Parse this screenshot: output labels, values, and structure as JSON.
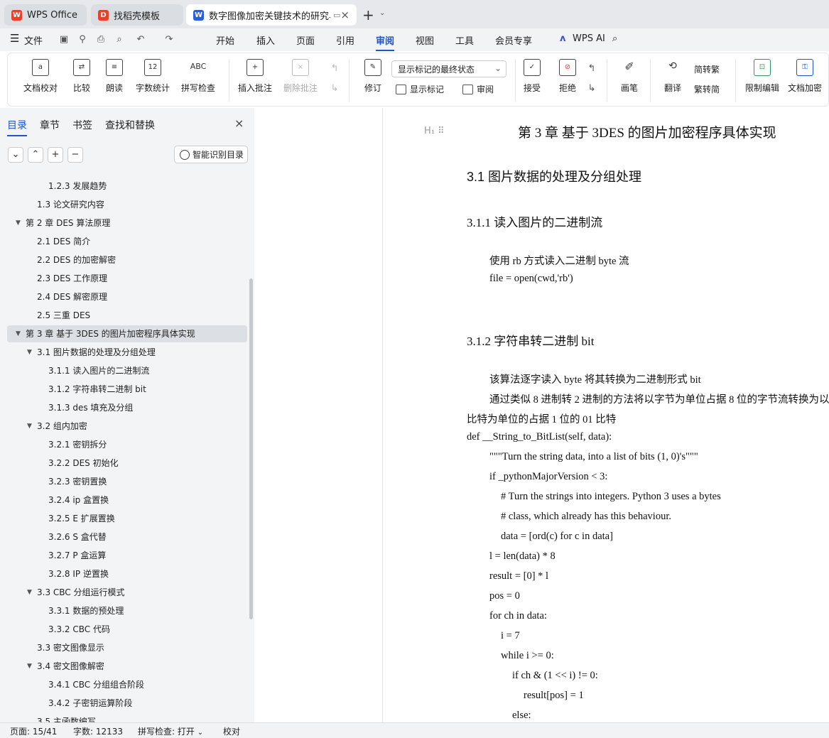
{
  "tabs": [
    {
      "label": "WPS Office",
      "icon": "wps-logo-icon",
      "active": false
    },
    {
      "label": "找稻壳模板",
      "icon": "docer-template-icon",
      "active": false
    },
    {
      "label": "数字图像加密关键技术的研究与",
      "icon": "word-doc-icon",
      "active": true
    }
  ],
  "menubar": {
    "file": "文件",
    "items": [
      "开始",
      "插入",
      "页面",
      "引用",
      "审阅",
      "视图",
      "工具",
      "会员专享"
    ],
    "active": "审阅",
    "ai": "WPS AI"
  },
  "ribbon": {
    "doc_proofread": "文档校对",
    "compare": "比较",
    "read_aloud": "朗读",
    "word_count": "字数统计",
    "spell_check": "拼写检查",
    "insert_comment": "插入批注",
    "delete_comment": "删除批注",
    "track_changes": "修订",
    "markup_mode": "显示标记的最终状态",
    "show_markup": "显示标记",
    "review_pane": "审阅",
    "accept": "接受",
    "reject": "拒绝",
    "pen": "画笔",
    "translate": "翻译",
    "to_traditional": "简转繁",
    "to_simplified": "繁转简",
    "restrict_edit": "限制编辑",
    "doc_encrypt": "文档加密"
  },
  "panel": {
    "tabs": [
      "目录",
      "章节",
      "书签",
      "查找和替换"
    ],
    "active_tab": "目录",
    "smart_toc": "智能识别目录",
    "toc": [
      {
        "label": "1.2.3 发展趋势",
        "level": 3
      },
      {
        "label": "1.3 论文研究内容",
        "level": 2
      },
      {
        "label": "第 2 章  DES 算法原理",
        "level": 1,
        "expanded": true
      },
      {
        "label": "2.1 DES 简介",
        "level": 2
      },
      {
        "label": "2.2 DES 的加密解密",
        "level": 2
      },
      {
        "label": "2.3 DES 工作原理",
        "level": 2
      },
      {
        "label": "2.4 DES 解密原理",
        "level": 2
      },
      {
        "label": "2.5 三重 DES",
        "level": 2
      },
      {
        "label": "第 3 章  基于 3DES 的图片加密程序具体实现",
        "level": 1,
        "expanded": true,
        "selected": true
      },
      {
        "label": "3.1 图片数据的处理及分组处理",
        "level": 2,
        "expanded": true
      },
      {
        "label": "3.1.1 读入图片的二进制流",
        "level": 3
      },
      {
        "label": "3.1.2 字符串转二进制 bit",
        "level": 3
      },
      {
        "label": "3.1.3 des 填充及分组",
        "level": 3
      },
      {
        "label": "3.2  组内加密",
        "level": 2,
        "expanded": true
      },
      {
        "label": "3.2.1  密钥拆分",
        "level": 3
      },
      {
        "label": "3.2.2 DES 初始化",
        "level": 3
      },
      {
        "label": "3.2.3  密钥置换",
        "level": 3
      },
      {
        "label": "3.2.4 ip 盒置换",
        "level": 3
      },
      {
        "label": "3.2.5 E 扩展置换",
        "level": 3
      },
      {
        "label": "3.2.6 S 盒代替",
        "level": 3
      },
      {
        "label": "3.2.7 P 盒运算",
        "level": 3
      },
      {
        "label": "3.2.8 IP 逆置换",
        "level": 3
      },
      {
        "label": "3.3 CBC 分组运行模式",
        "level": 2,
        "expanded": true
      },
      {
        "label": "3.3.1  数据的预处理",
        "level": 3
      },
      {
        "label": "3.3.2 CBC 代码",
        "level": 3
      },
      {
        "label": "3.3  密文图像显示",
        "level": 2
      },
      {
        "label": "3.4  密文图像解密",
        "level": 2,
        "expanded": true
      },
      {
        "label": "3.4.1 CBC 分组组合阶段",
        "level": 3
      },
      {
        "label": "3.4.2  子密钥运算阶段",
        "level": 3
      },
      {
        "label": "3.5  主函数编写",
        "level": 2
      }
    ]
  },
  "document": {
    "chapter_title": "第 3 章  基于 3DES 的图片加密程序具体实现",
    "h2": "3.1 图片数据的处理及分组处理",
    "h3a": "3.1.1 读入图片的二进制流",
    "p1": "使用 rb 方式读入二进制 byte 流",
    "p2": "file = open(cwd,'rb')",
    "h3b": "3.1.2 字符串转二进制 bit",
    "p3": "该算法逐字读入 byte 将其转换为二进制形式 bit",
    "p4": "通过类似 8 进制转 2 进制的方法将以字节为单位占据 8 位的字节流转换为以",
    "p5": "比特为单位的占据 1 位的 01 比特",
    "code": [
      "def __String_to_BitList(self, data):",
      "\"\"\"Turn the string data, into a list of bits (1, 0)'s\"\"\"",
      "if _pythonMajorVersion < 3:",
      "# Turn the strings into integers. Python 3 uses a bytes",
      "# class, which already has this behaviour.",
      "data = [ord(c) for c in data]",
      "l = len(data) * 8",
      "result = [0] * l",
      "pos = 0",
      "for ch in data:",
      "i = 7",
      "while i >= 0:",
      "if ch & (1 << i) != 0:",
      "result[pos] = 1",
      "else:"
    ]
  },
  "status": {
    "page": "页面: 15/41",
    "words": "字数: 12133",
    "spell": "拼写检查: 打开",
    "proof": "校对"
  },
  "colors": {
    "accent": "#1a56db",
    "wps_red": "#e8412c",
    "doc_blue": "#2b5fd9"
  }
}
